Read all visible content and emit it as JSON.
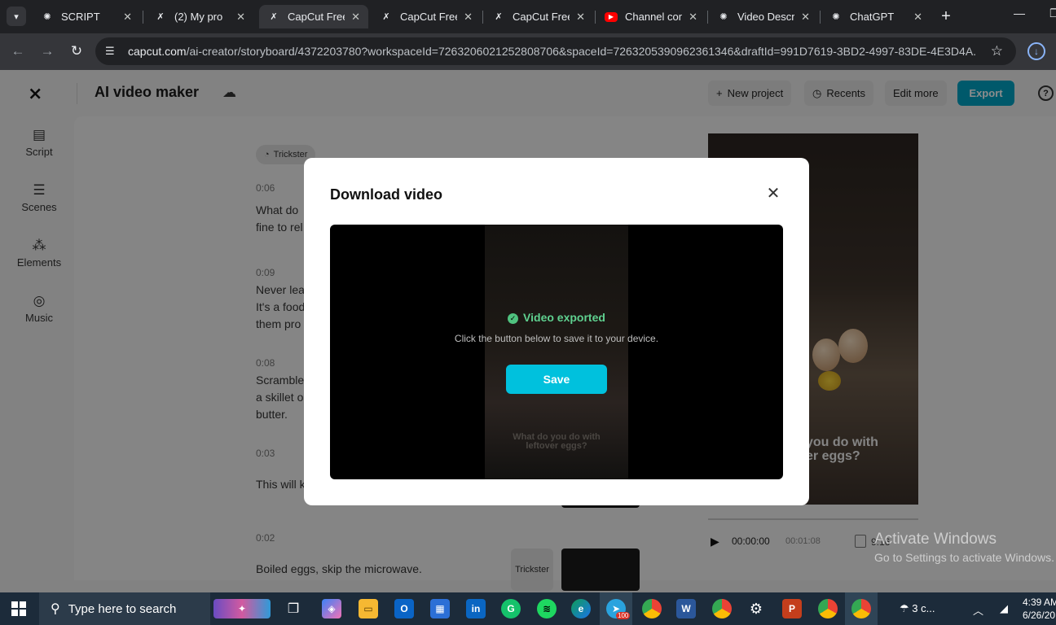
{
  "browser": {
    "tabs": [
      {
        "title": "SCRIPT",
        "icon": "chatgpt-icon"
      },
      {
        "title": "(2) My pro",
        "icon": "capcut-icon"
      },
      {
        "title": "CapCut Free",
        "icon": "capcut-icon",
        "active": true
      },
      {
        "title": "CapCut Free",
        "icon": "capcut-icon"
      },
      {
        "title": "CapCut Free",
        "icon": "capcut-icon"
      },
      {
        "title": "Channel con",
        "icon": "youtube-icon"
      },
      {
        "title": "Video Descri",
        "icon": "chatgpt-icon"
      },
      {
        "title": "ChatGPT",
        "icon": "chatgpt-icon"
      }
    ],
    "url_host": "capcut.com",
    "url_path": "/ai-creator/storyboard/4372203780?workspaceId=7263206021252808706&spaceId=7263205390962361346&draftId=991D7619-3BD2-4997-83DE-4E3D4A..."
  },
  "app": {
    "title": "AI video maker",
    "buttons": {
      "new_project": "New project",
      "recents": "Recents",
      "edit_more": "Edit more",
      "export": "Export"
    },
    "sidebar": [
      {
        "label": "Script",
        "icon": "script-icon"
      },
      {
        "label": "Scenes",
        "icon": "scenes-icon"
      },
      {
        "label": "Elements",
        "icon": "elements-icon"
      },
      {
        "label": "Music",
        "icon": "music-icon"
      }
    ],
    "voice": "Trickster",
    "script": [
      {
        "time": "0:06",
        "lines": [
          "What do",
          "fine to rel"
        ]
      },
      {
        "time": "0:09",
        "lines": [
          "Never lea",
          "It's a food",
          "them pro"
        ]
      },
      {
        "time": "0:08",
        "lines": [
          "Scramble",
          "a skillet o",
          "butter."
        ]
      },
      {
        "time": "0:03",
        "lines": [
          "This will k"
        ]
      },
      {
        "time": "0:02",
        "lines": [
          "Boiled eggs, skip the microwave."
        ]
      }
    ],
    "scene_voice": "Trickster",
    "preview": {
      "caption_line1": "you do with",
      "caption_line2": "er eggs?",
      "current_time": "00:00:00",
      "total_time": "00:01:08",
      "ratio": "9:16"
    }
  },
  "modal": {
    "title": "Download video",
    "status": "Video exported",
    "hint": "Click the button below to save it to your device.",
    "save_label": "Save",
    "frame_caption_line1": "What do you do with",
    "frame_caption_line2": "leftover eggs?"
  },
  "watermark": {
    "line1": "Activate Windows",
    "line2": "Go to Settings to activate Windows."
  },
  "taskbar": {
    "search_placeholder": "Type here to search",
    "weather": "3 c...",
    "time": "4:39 AM",
    "date": "6/26/20",
    "telegram_badge": "100"
  }
}
